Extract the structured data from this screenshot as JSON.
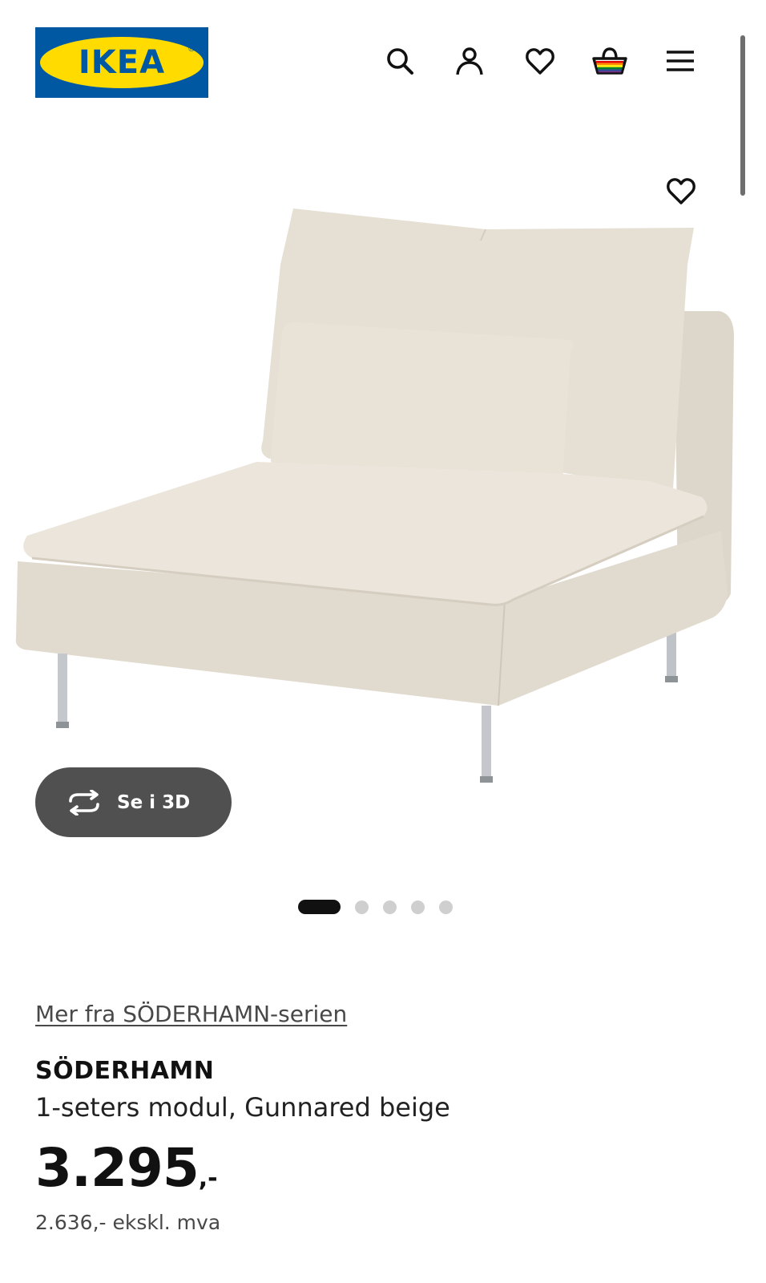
{
  "header": {
    "logo_text": "IKEA",
    "logo_reg": "®",
    "icons": [
      "search-icon",
      "user-icon",
      "heart-icon",
      "basket-icon",
      "menu-icon"
    ]
  },
  "gallery": {
    "view_3d_label": "Se i 3D",
    "image_count": 5,
    "active_index": 0
  },
  "product": {
    "series_link": "Mer fra SÖDERHAMN-serien",
    "name": "SÖDERHAMN",
    "description": "1-seters modul, Gunnared beige",
    "price_main": "3.295",
    "price_suffix": ",-",
    "price_ex_vat": "2.636,- ekskl. mva"
  },
  "colors": {
    "brand_blue": "#0058a3",
    "brand_yellow": "#ffdb00",
    "button_dark": "#505050",
    "fabric_beige": "#e4ddd2"
  }
}
